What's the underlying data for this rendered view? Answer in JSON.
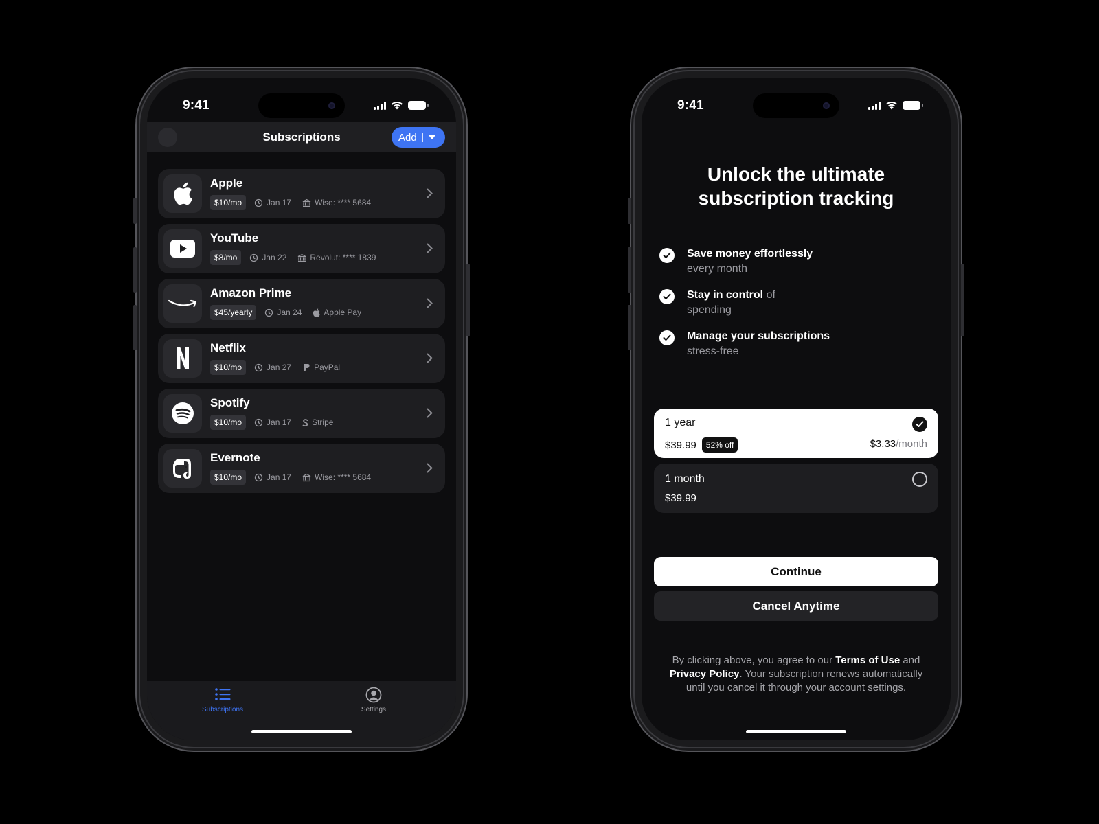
{
  "status_bar": {
    "time": "9:41"
  },
  "subscriptions_screen": {
    "title": "Subscriptions",
    "add_label": "Add",
    "items": [
      {
        "name": "Apple",
        "price": "$10/mo",
        "date": "Jan 17",
        "payment": "Wise: **** 5684",
        "logo": "apple-icon",
        "payment_icon": "bank-icon"
      },
      {
        "name": "YouTube",
        "price": "$8/mo",
        "date": "Jan 22",
        "payment": "Revolut: **** 1839",
        "logo": "youtube-icon",
        "payment_icon": "bank-icon"
      },
      {
        "name": "Amazon Prime",
        "price": "$45/yearly",
        "date": "Jan 24",
        "payment": "Apple Pay",
        "logo": "amazon-icon",
        "payment_icon": "apple-icon"
      },
      {
        "name": "Netflix",
        "price": "$10/mo",
        "date": "Jan 27",
        "payment": "PayPal",
        "logo": "netflix-icon",
        "payment_icon": "paypal-icon"
      },
      {
        "name": "Spotify",
        "price": "$10/mo",
        "date": "Jan 17",
        "payment": "Stripe",
        "logo": "spotify-icon",
        "payment_icon": "stripe-icon"
      },
      {
        "name": "Evernote",
        "price": "$10/mo",
        "date": "Jan 17",
        "payment": "Wise: **** 5684",
        "logo": "evernote-icon",
        "payment_icon": "bank-icon"
      }
    ],
    "tabs": [
      {
        "label": "Subscriptions",
        "icon": "list-icon",
        "active": true
      },
      {
        "label": "Settings",
        "icon": "profile-icon",
        "active": false
      }
    ],
    "accent": "#3e74f3"
  },
  "paywall_screen": {
    "title_line1": "Unlock the ultimate",
    "title_line2": "subscription tracking",
    "features": [
      {
        "highlight": "Save money effortlessly",
        "rest": "every month"
      },
      {
        "highlight": "Stay in control",
        "rest_inline": "of",
        "rest": "spending"
      },
      {
        "highlight": "Manage your subscriptions",
        "rest": "stress-free"
      }
    ],
    "plans": [
      {
        "name": "1 year",
        "price": "$39.99",
        "badge": "52% off",
        "per_month": "$3.33",
        "per_month_unit": "/month",
        "selected": true
      },
      {
        "name": "1 month",
        "price": "$39.99",
        "selected": false
      }
    ],
    "continue_label": "Continue",
    "cancel_label": "Cancel Anytime",
    "legal": {
      "p1": "By clicking above, you agree to our ",
      "terms": "Terms of Use",
      "p2": " and ",
      "privacy": "Privacy Policy",
      "p3": ". Your subscription renews automatically until you cancel it through your account settings."
    }
  }
}
